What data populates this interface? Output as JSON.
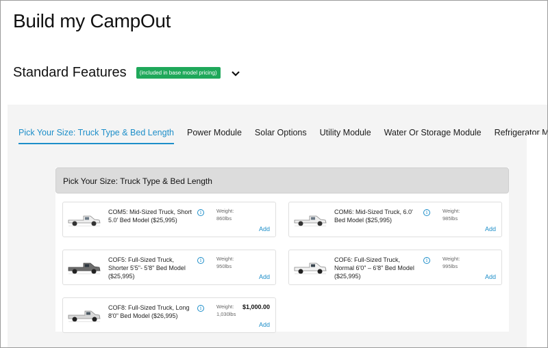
{
  "page": {
    "title": "Build my CampOut"
  },
  "features": {
    "title": "Standard Features",
    "badge": "(included in base model pricing)",
    "toggle_icon": "chevron-down-icon"
  },
  "tabs": [
    {
      "label": "Pick Your Size: Truck Type & Bed Length",
      "active": true
    },
    {
      "label": "Power Module",
      "active": false
    },
    {
      "label": "Solar Options",
      "active": false
    },
    {
      "label": "Utility Module",
      "active": false
    },
    {
      "label": "Water Or Storage Module",
      "active": false
    },
    {
      "label": "Refrigerator Module",
      "active": false
    }
  ],
  "section": {
    "title": "Pick Your Size: Truck Type & Bed Length"
  },
  "colors": {
    "accent": "#1d8ec9",
    "badge": "#1fa85a",
    "panel": "#f4f4f4",
    "header": "#dcdcdc"
  },
  "options": [
    {
      "name": "COM5: Mid-Sized Truck, Short 5.0' Bed Model ($25,995)",
      "weight_label": "Weight:",
      "weight": "860lbs",
      "price": "",
      "add_label": "Add",
      "icon": "truck-icon"
    },
    {
      "name": "COM6: Mid-Sized Truck, 6.0' Bed Model ($25,995)",
      "weight_label": "Weight:",
      "weight": "985lbs",
      "price": "",
      "add_label": "Add",
      "icon": "truck-icon"
    },
    {
      "name": "COF5: Full-Sized Truck, Shorter 5'5\"- 5'8\" Bed Model ($25,995)",
      "weight_label": "Weight:",
      "weight": "950lbs",
      "price": "",
      "add_label": "Add",
      "icon": "truck-icon"
    },
    {
      "name": "COF6: Full-Sized Truck, Normal 6'0\" – 6'8\" Bed Model ($25,995)",
      "weight_label": "Weight:",
      "weight": "995lbs",
      "price": "",
      "add_label": "Add",
      "icon": "truck-icon"
    },
    {
      "name": "COF8: Full-Sized Truck, Long 8'0\" Bed Model ($26,995)",
      "weight_label": "Weight:",
      "weight": "1,030lbs",
      "price": "$1,000.00",
      "add_label": "Add",
      "icon": "truck-icon"
    }
  ]
}
